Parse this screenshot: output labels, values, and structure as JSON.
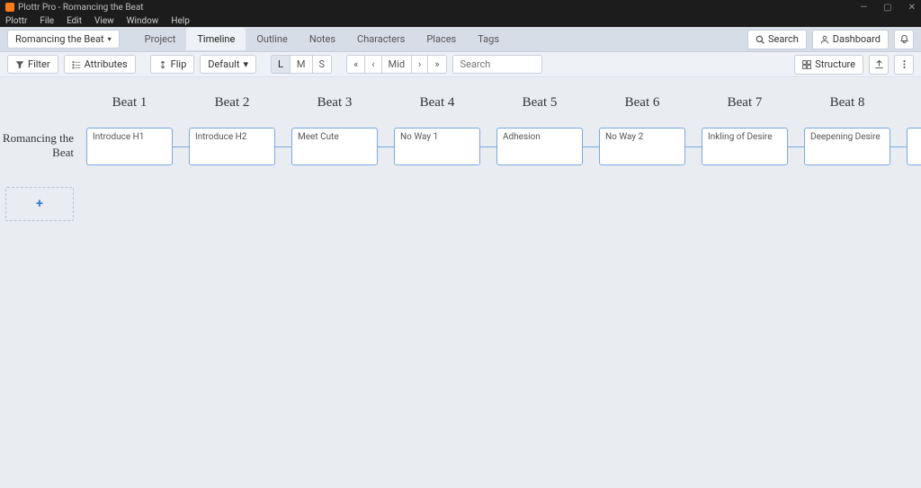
{
  "window": {
    "title": "Plottr Pro - Romancing the Beat",
    "min_icon": "—",
    "max_icon": "▢",
    "close_icon": "✕"
  },
  "menubar": [
    "Plottr",
    "File",
    "Edit",
    "View",
    "Window",
    "Help"
  ],
  "book_dropdown": "Romancing the Beat",
  "nav_tabs": [
    "Project",
    "Timeline",
    "Outline",
    "Notes",
    "Characters",
    "Places",
    "Tags"
  ],
  "nav_active_index": 1,
  "top_right": {
    "search": "Search",
    "dashboard": "Dashboard"
  },
  "toolbar": {
    "filter": "Filter",
    "attributes": "Attributes",
    "flip": "Flip",
    "default": "Default",
    "zoom": [
      "L",
      "M",
      "S"
    ],
    "zoom_active": 0,
    "nav_first": "«",
    "nav_prev": "‹",
    "nav_mid": "Mid",
    "nav_next": "›",
    "nav_last": "»",
    "search_placeholder": "Search",
    "structure": "Structure"
  },
  "beats": [
    "Beat 1",
    "Beat 2",
    "Beat 3",
    "Beat 4",
    "Beat 5",
    "Beat 6",
    "Beat 7",
    "Beat 8"
  ],
  "plotline_label": "Romancing the Beat",
  "cards": [
    "Introduce H1",
    "Introduce H2",
    "Meet Cute",
    "No Way 1",
    "Adhesion",
    "No Way 2",
    "Inkling of Desire",
    "Deepening Desire"
  ]
}
